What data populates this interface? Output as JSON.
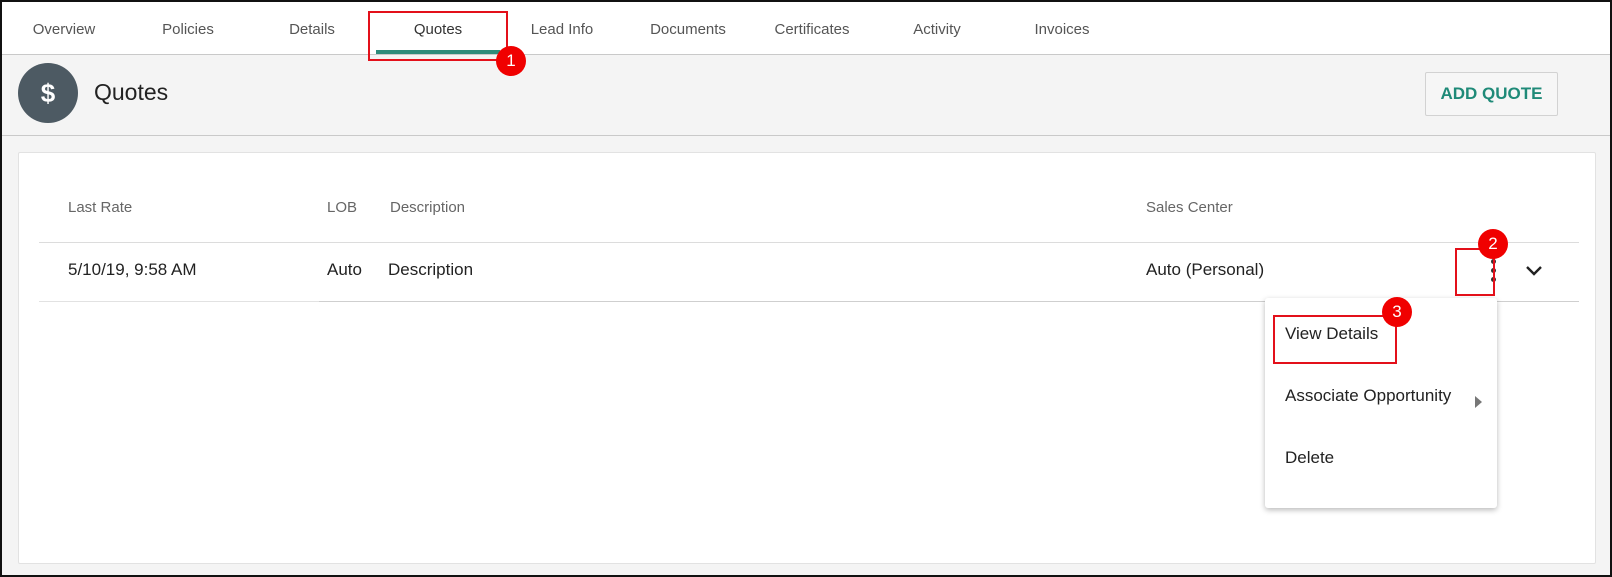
{
  "tabs": [
    {
      "label": "Overview"
    },
    {
      "label": "Policies"
    },
    {
      "label": "Details"
    },
    {
      "label": "Quotes"
    },
    {
      "label": "Lead Info"
    },
    {
      "label": "Documents"
    },
    {
      "label": "Certificates"
    },
    {
      "label": "Activity"
    },
    {
      "label": "Invoices"
    }
  ],
  "header": {
    "icon_glyph": "$",
    "title": "Quotes",
    "add_button_label": "ADD QUOTE"
  },
  "table": {
    "columns": [
      "Last Rate",
      "LOB",
      "Description",
      "Sales Center"
    ],
    "rows": [
      {
        "last_rate": "5/10/19, 9:58 AM",
        "lob": "Auto",
        "description": "Description",
        "sales_center": "Auto (Personal)"
      }
    ]
  },
  "menu": {
    "items": [
      {
        "label": "View Details"
      },
      {
        "label": "Associate Opportunity"
      },
      {
        "label": "Delete"
      }
    ]
  },
  "annotations": [
    "1",
    "2",
    "3"
  ],
  "colors": {
    "accent": "#2e8b7a",
    "avatar": "#4d5a63",
    "annotation": "#e3101a"
  }
}
